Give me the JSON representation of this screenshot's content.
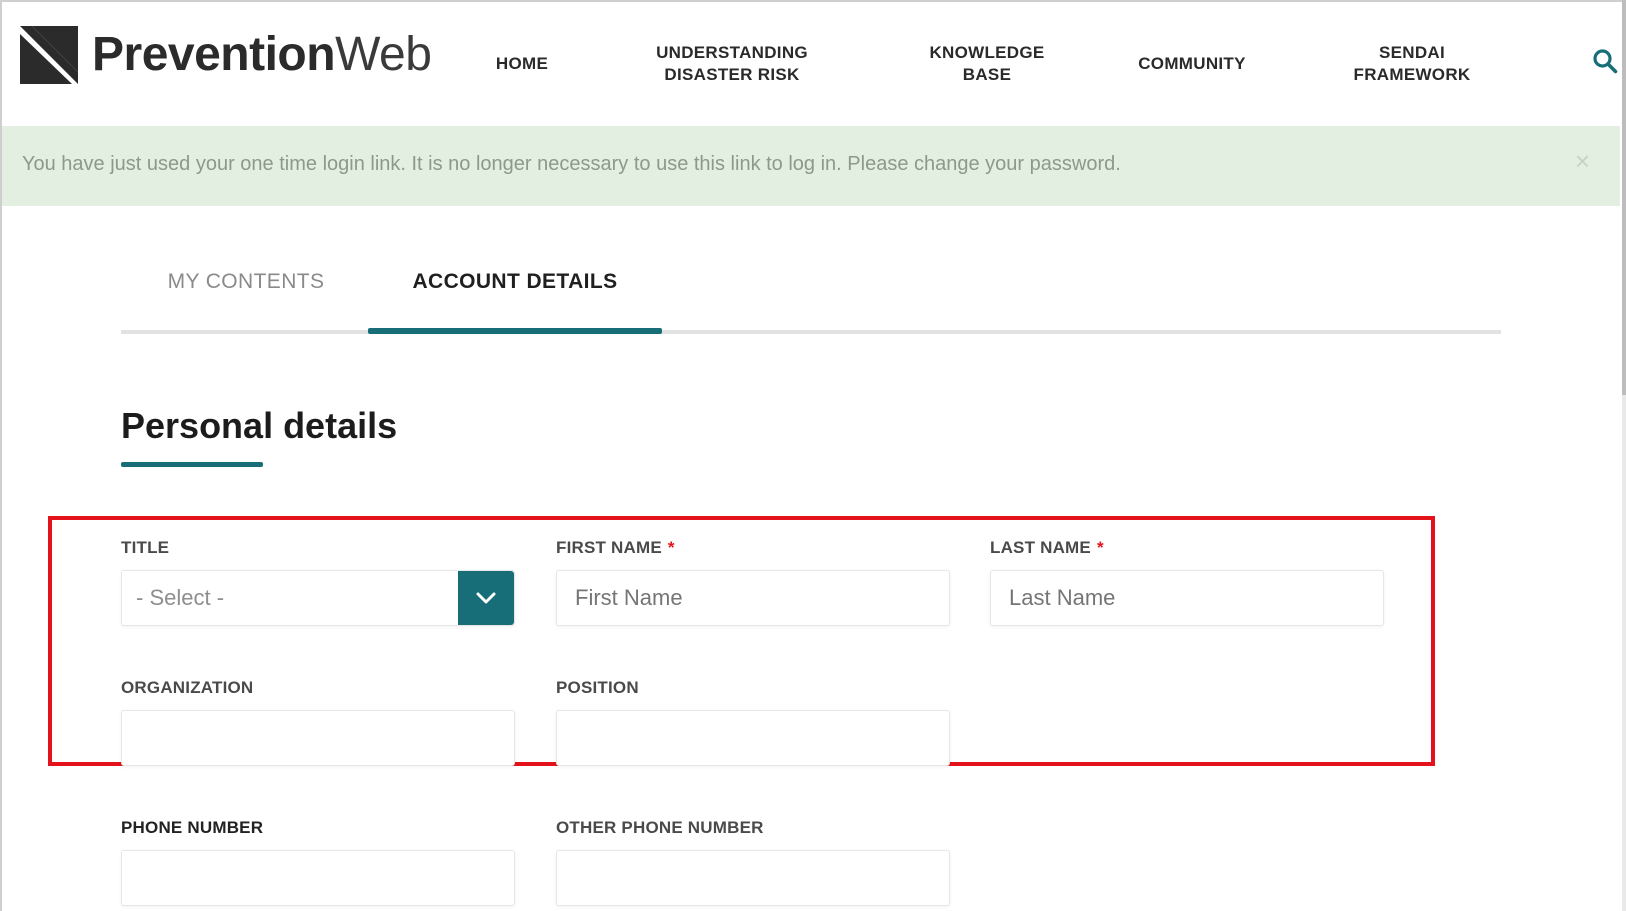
{
  "header": {
    "logo": {
      "bold": "Prevention",
      "light": "Web"
    },
    "nav": [
      {
        "lines": [
          "HOME"
        ]
      },
      {
        "lines": [
          "UNDERSTANDING",
          "DISASTER RISK"
        ]
      },
      {
        "lines": [
          "KNOWLEDGE",
          "BASE"
        ]
      },
      {
        "lines": [
          "COMMUNITY"
        ]
      },
      {
        "lines": [
          "SENDAI",
          "FRAMEWORK"
        ]
      }
    ],
    "search_icon": "search-icon"
  },
  "alert": {
    "message": "You have just used your one time login link. It is no longer necessary to use this link to log in. Please change your password.",
    "close_symbol": "×"
  },
  "tabs": [
    {
      "label": "MY CONTENTS",
      "active": false
    },
    {
      "label": "ACCOUNT DETAILS",
      "active": true
    }
  ],
  "section": {
    "title": "Personal details"
  },
  "form": {
    "title": {
      "label": "TITLE",
      "value": "- Select -"
    },
    "first_name": {
      "label": "FIRST NAME",
      "required_mark": "*",
      "placeholder": "First Name"
    },
    "last_name": {
      "label": "LAST NAME",
      "required_mark": "*",
      "placeholder": "Last Name"
    },
    "organization": {
      "label": "ORGANIZATION",
      "value": ""
    },
    "position": {
      "label": "POSITION",
      "value": ""
    },
    "phone_number": {
      "label": "PHONE NUMBER",
      "value": ""
    },
    "other_phone_number": {
      "label": "OTHER PHONE NUMBER",
      "value": ""
    }
  },
  "colors": {
    "accent": "#176e78",
    "alert_bg": "#e3efe1",
    "highlight": "#e3121b"
  }
}
